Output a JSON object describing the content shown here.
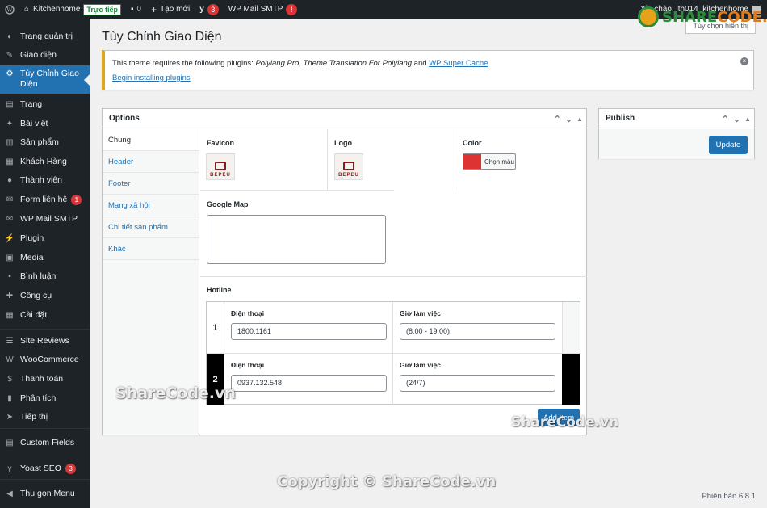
{
  "adminbar": {
    "site_name": "Kitchenhome",
    "live_badge": "Trực tiếp",
    "comments_count": "0",
    "new_label": "Tạo mới",
    "yoast_count": "3",
    "smtp_label": "WP Mail SMTP",
    "smtp_badge": "!",
    "greeting": "Xin chào, lth014_kitchenhome"
  },
  "sidebar": {
    "items": [
      {
        "label": "Trang quản trị",
        "icon": "dashboard-icon"
      },
      {
        "label": "Giao diện",
        "icon": "appearance-icon"
      },
      {
        "label": "Tùy Chỉnh Giao Diện",
        "icon": "gear-icon",
        "current": true
      },
      {
        "label": "Trang",
        "icon": "pages-icon"
      },
      {
        "label": "Bài viết",
        "icon": "pin-icon"
      },
      {
        "label": "Sản phẩm",
        "icon": "products-icon"
      },
      {
        "label": "Khách Hàng",
        "icon": "customers-icon"
      },
      {
        "label": "Thành viên",
        "icon": "users-icon"
      },
      {
        "label": "Form liên hệ",
        "icon": "mail-icon",
        "badge": "1"
      },
      {
        "label": "WP Mail SMTP",
        "icon": "smtp-icon"
      },
      {
        "label": "Plugin",
        "icon": "plugin-icon"
      },
      {
        "label": "Media",
        "icon": "media-icon"
      },
      {
        "label": "Bình luận",
        "icon": "comments-icon"
      },
      {
        "label": "Công cụ",
        "icon": "tools-icon"
      },
      {
        "label": "Cài đặt",
        "icon": "settings-icon"
      },
      {
        "label": "Site Reviews",
        "icon": "reviews-icon"
      },
      {
        "label": "WooCommerce",
        "icon": "woocommerce-icon"
      },
      {
        "label": "Thanh toán",
        "icon": "payment-icon"
      },
      {
        "label": "Phân tích",
        "icon": "analytics-icon"
      },
      {
        "label": "Tiếp thị",
        "icon": "marketing-icon"
      },
      {
        "label": "Custom Fields",
        "icon": "custom-fields-icon"
      },
      {
        "label": "Yoast SEO",
        "icon": "yoast-icon",
        "badge": "3"
      },
      {
        "label": "Thu gọn Menu",
        "icon": "collapse-icon"
      }
    ]
  },
  "page": {
    "title": "Tùy Chỉnh Giao Diện",
    "screen_options": "Tùy chọn hiển thị"
  },
  "notice": {
    "text_prefix": "This theme requires the following plugins: ",
    "plugins_italic": "Polylang Pro, Theme Translation For Polylang",
    "text_and": " and ",
    "plugin_link": "WP Super Cache",
    "text_suffix": ".",
    "install_link": "Begin installing plugins"
  },
  "options": {
    "title": "Options",
    "tabs": [
      "Chung",
      "Header",
      "Footer",
      "Mạng xã hội",
      "Chi tiết sản phẩm",
      "Khác"
    ],
    "favicon_label": "Favicon",
    "logo_label": "Logo",
    "logo_text": "BEPEU",
    "color_label": "Color",
    "color_button": "Chọn màu",
    "color_value": "#dd3333",
    "google_map_label": "Google Map",
    "hotline_label": "Hotline",
    "hotline_rows": [
      {
        "num": "1",
        "phone_label": "Điện thoại",
        "phone": "1800.1161",
        "hours_label": "Giờ làm việc",
        "hours": "(8:00 - 19:00)"
      },
      {
        "num": "2",
        "phone_label": "Điện thoại",
        "phone": "0937.132.548",
        "hours_label": "Giờ làm việc",
        "hours": "(24/7)"
      }
    ],
    "add_item": "Add Item"
  },
  "publish": {
    "title": "Publish",
    "update_button": "Update"
  },
  "footer": {
    "version": "Phiên bản 6.8.1"
  },
  "watermarks": {
    "logo_prefix": "SHARE",
    "logo_suffix": "CODE.vn",
    "left": "ShareCode.vn",
    "right": "ShareCode.vn",
    "copyright": "Copyright © ShareCode.vn"
  },
  "colors": {
    "accent": "#2271b1",
    "admin_bg": "#1d2327",
    "notice_border": "#dba617"
  }
}
